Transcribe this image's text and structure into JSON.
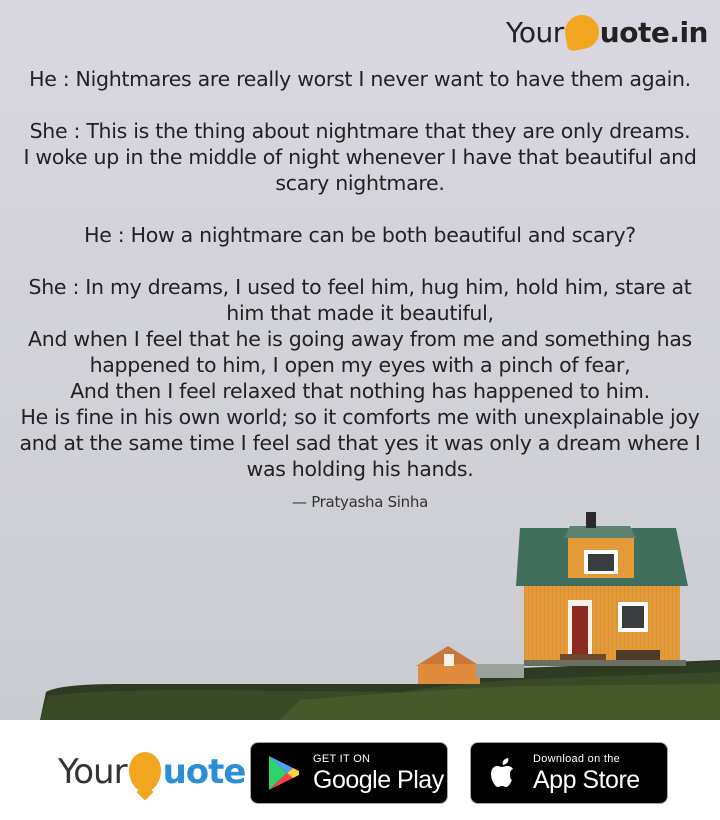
{
  "brand": {
    "prefix": "Your",
    "suffix": "uote.in"
  },
  "quote": {
    "lines": [
      "He : Nightmares are really worst I never want to have them again.",
      "She : This is the thing about nightmare that they are only dreams.",
      "I woke up in the middle of night whenever I have that beautiful and",
      "scary nightmare.",
      "He : How a nightmare can be both beautiful and scary?",
      "She : In my dreams, I used to feel him, hug him, hold him, stare at",
      "him  that made it beautiful,",
      "And when I feel that he is going away from me and something has",
      "happened to him, I open my eyes with a pinch of fear,",
      "And then I feel relaxed that nothing has happened to him.",
      "He is fine in his own world; so it comforts me with unexplainable joy",
      "and at the same time I feel sad that yes it was only a dream  where I",
      "was holding his hands."
    ],
    "author": "— Pratyasha Sinha"
  },
  "footer": {
    "logo_prefix": "Your",
    "logo_suffix": "uote",
    "google_play": {
      "small": "GET IT ON",
      "big": "Google Play"
    },
    "app_store": {
      "small": "Download on the",
      "big": "App Store"
    }
  },
  "colors": {
    "accent_orange": "#f2a51f",
    "logo_blue": "#2a8fd6",
    "house_orange": "#e59a3a",
    "roof_green": "#3f6e5c"
  },
  "icons": {
    "google_play": "google-play-icon",
    "app_store": "apple-icon"
  }
}
